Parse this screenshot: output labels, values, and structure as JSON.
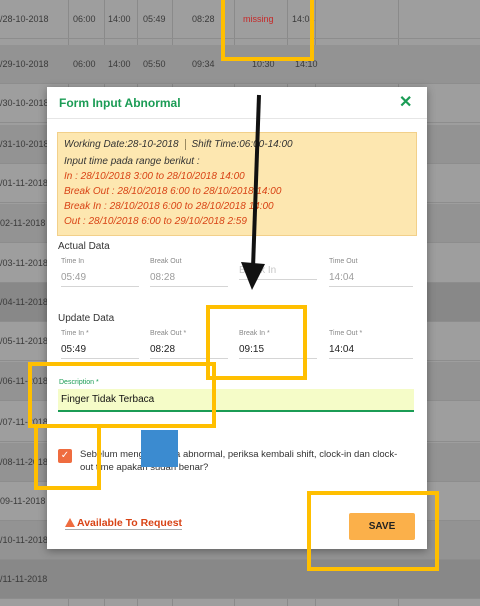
{
  "background_table": {
    "rows": [
      {
        "date": "/28-10-2018",
        "c1": "06:00",
        "c2": "14:00",
        "c3": "05:49",
        "c4": "08:28",
        "status": "missing",
        "c6": "14:04"
      },
      {
        "date": "/29-10-2018",
        "c1": "06:00",
        "c2": "14:00",
        "c3": "05:50",
        "c4": "09:34",
        "status": "10:30",
        "c6": "14:10"
      },
      {
        "date": "/30-10-2018"
      },
      {
        "date": "/31-10-2018"
      },
      {
        "date": "/01-11-2018"
      },
      {
        "date": "02-11-2018"
      },
      {
        "date": "/03-11-2018"
      },
      {
        "date": "/04-11-2018"
      },
      {
        "date": "/05-11-2018"
      },
      {
        "date": "/06-11-2018"
      },
      {
        "date": "/07-11-2018"
      },
      {
        "date": "/08-11-2018"
      },
      {
        "date": "09-11-2018"
      },
      {
        "date": "/10-11-2018"
      },
      {
        "date": "/11-11-2018"
      }
    ]
  },
  "modal": {
    "title": "Form Input Abnormal",
    "close_icon": "close-icon",
    "info": {
      "working_date": "Working Date:28-10-2018",
      "shift_time": "Shift Time:06:00-14:00",
      "range_label": "Input time pada range berikut :",
      "in_range": "In : 28/10/2018 3:00 to 28/10/2018 14:00",
      "break_out_range": "Break Out : 28/10/2018 6:00 to 28/10/2018 14:00",
      "break_in_range": "Break In : 28/10/2018 6:00 to 28/10/2018 14:00",
      "out_range": "Out : 28/10/2018 6:00 to 29/10/2018 2:59"
    },
    "actual": {
      "title": "Actual Data",
      "fields": [
        {
          "label": "Time In",
          "value": "05:49"
        },
        {
          "label": "Break Out",
          "value": "08:28"
        },
        {
          "label": "Break In",
          "value": "Break In"
        },
        {
          "label": "Time Out",
          "value": "14:04"
        }
      ]
    },
    "update": {
      "title": "Update Data",
      "fields": [
        {
          "label": "Time In *",
          "value": "05:49"
        },
        {
          "label": "Break Out *",
          "value": "08:28"
        },
        {
          "label": "Break In *",
          "value": "09:15"
        },
        {
          "label": "Time Out *",
          "value": "14:04"
        }
      ]
    },
    "description": {
      "label": "Description *",
      "value": "Finger Tidak Terbaca"
    },
    "confirm_text": "Sebelum mengirim data abnormal, periksa kembali shift, clock-in dan clock-out time apakah sudah benar?",
    "available_label": "Available To Request",
    "save_label": "SAVE"
  },
  "colors": {
    "accent": "#1b9c55",
    "save_button": "#fbb04a",
    "highlight": "#ffbf00",
    "warning_text": "#d84315"
  }
}
